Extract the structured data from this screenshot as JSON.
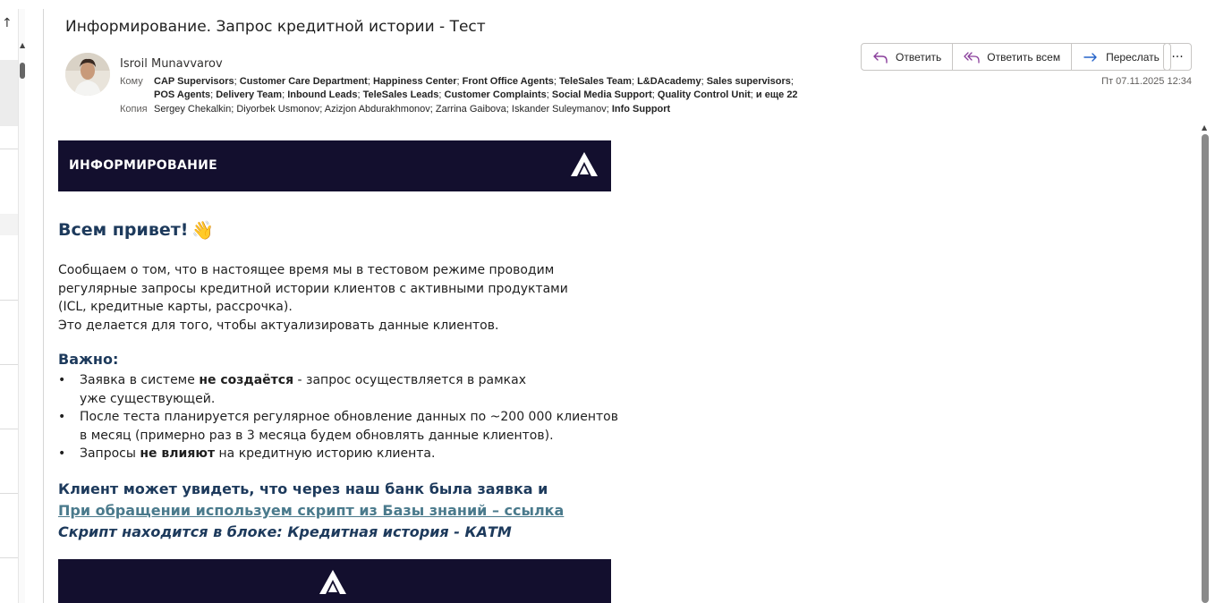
{
  "subject": "Информирование. Запрос кредитной истории - Тест",
  "sender": {
    "name": "Isroil Munavvarov"
  },
  "to_label": "Кому",
  "to_line1": [
    "CAP Supervisors",
    "Customer Care Department",
    "Happiness Center",
    "Front Office Agents",
    "TeleSales Team",
    "L&DAcademy",
    "Sales supervisors"
  ],
  "to_line2": [
    "POS Agents",
    "Delivery Team",
    "Inbound Leads",
    "TeleSales Leads",
    "Customer Complaints",
    "Social Media Support",
    "Quality Control Unit"
  ],
  "to_more": "и еще 22",
  "cc_label": "Копия",
  "cc": [
    "Sergey Chekalkin",
    "Diyorbek Usmonov",
    "Azizjon Abdurakhmonov",
    "Zarrina Gaibova",
    "Iskander Suleymanov"
  ],
  "cc_bold": "Info Support",
  "actions": {
    "reply": "Ответить",
    "reply_all": "Ответить всем",
    "forward": "Переслать",
    "more": "···"
  },
  "datetime": "Пт 07.11.2025 12:34",
  "body": {
    "banner_title": "ИНФОРМИРОВАНИЕ",
    "greeting": "Всем привет!",
    "greeting_emoji": "👋",
    "p1_lines": [
      "Сообщаем о том, что в настоящее время мы в тестовом режиме проводим",
      "регулярные запросы кредитной истории клиентов с активными продуктами",
      "(ICL, кредитные карты, рассрочка).",
      "Это делается для того, чтобы актуализировать данные клиентов."
    ],
    "important_heading": "Важно:",
    "bullets": {
      "b1_pre": "Заявка в системе ",
      "b1_bold": "не создаётся",
      "b1_post": " - запрос осуществляется в рамках",
      "b1_line2": "уже существующей.",
      "b2_line1": "После теста планируется регулярное обновление данных по ~200 000 клиентов",
      "b2_line2": "в месяц (примерно раз в 3 месяца будем обновлять данные клиентов).",
      "b3_pre": "Запросы ",
      "b3_bold": "не влияют",
      "b3_post": " на кредитную историю клиента."
    },
    "client_line": "Клиент может увидеть, что через наш банк была заявка и",
    "script_link": "При обращении используем скрипт из Базы знаний – ссылка",
    "script_location": "Скрипт находится в блоке: Кредитная история - КАТМ"
  },
  "colors": {
    "banner_bg": "#130f2e",
    "heading": "#1d3a5c",
    "link": "#4a7a8c",
    "reply_icon": "#8a3f9c",
    "forward_icon": "#2563c9"
  }
}
